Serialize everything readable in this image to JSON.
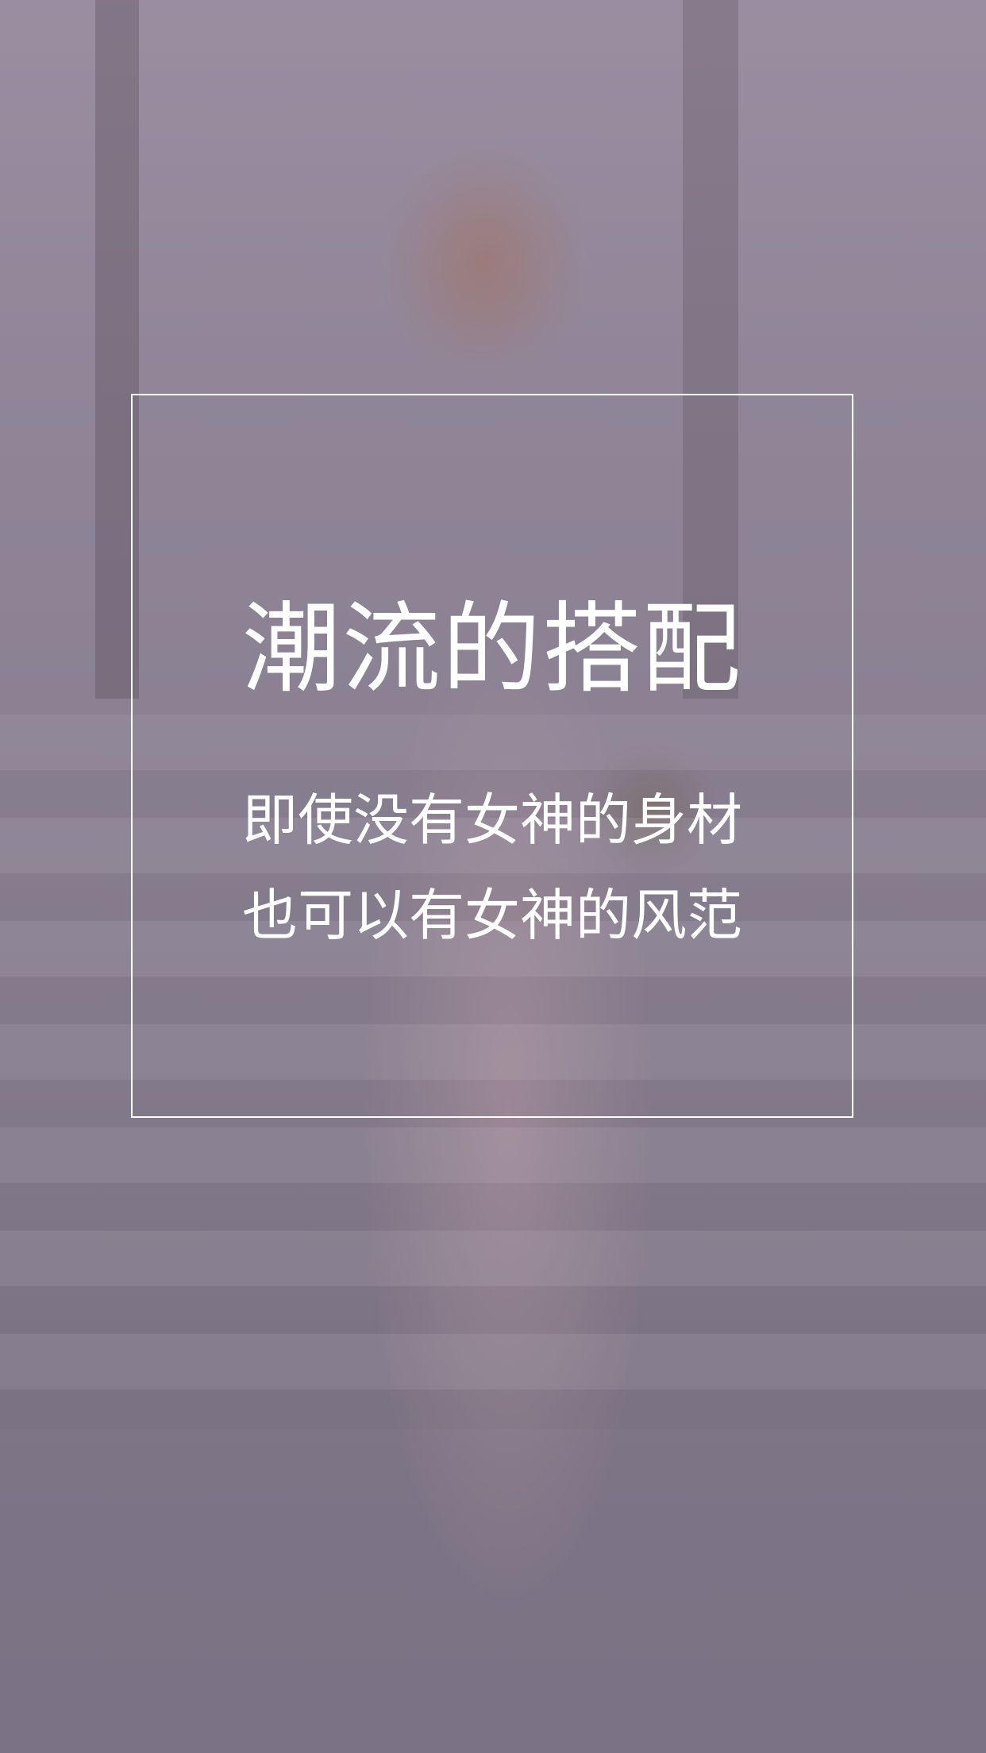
{
  "splash": {
    "headline": "潮流的搭配",
    "sublines": [
      "即使没有女神的身材",
      "也可以有女神的风范"
    ]
  },
  "colors": {
    "overlay": "#5f506e",
    "text": "#ffffff",
    "frame_border": "#ffffff"
  }
}
